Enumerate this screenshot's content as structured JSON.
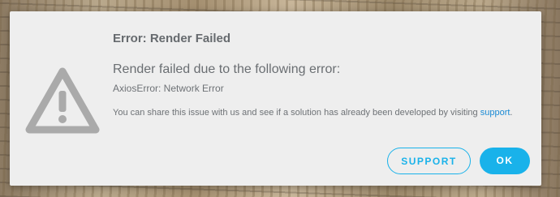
{
  "dialog": {
    "title": "Error: Render Failed",
    "headline": "Render failed due to the following error:",
    "error_detail": "AxiosError: Network Error",
    "info_text": "You can share this issue with us and see if a solution has already been developed by visiting ",
    "info_link": "support",
    "info_suffix": ".",
    "icon": "warning-triangle-icon"
  },
  "buttons": {
    "support_label": "SUPPORT",
    "ok_label": "OK"
  },
  "colors": {
    "accent": "#19b2ea",
    "link": "#1a8ad4",
    "dialog_bg": "#eeeeee",
    "icon": "#aaaaaa"
  }
}
